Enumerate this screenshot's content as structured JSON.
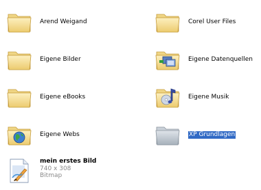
{
  "items": [
    {
      "label": "Arend Weigand",
      "icon": "folder-icon"
    },
    {
      "label": "Corel User Files",
      "icon": "folder-icon"
    },
    {
      "label": "Eigene Bilder",
      "icon": "folder-icon"
    },
    {
      "label": "Eigene Datenquellen",
      "icon": "data-sources-folder-icon"
    },
    {
      "label": "Eigene eBooks",
      "icon": "folder-icon"
    },
    {
      "label": "Eigene Musik",
      "icon": "music-folder-icon"
    },
    {
      "label": "Eigene Webs",
      "icon": "web-folder-icon"
    },
    {
      "label": "XP Grundlagen",
      "icon": "folder-icon",
      "selected": true
    }
  ],
  "file": {
    "name": "mein erstes Bild",
    "dimensions": "740 x 308",
    "type": "Bitmap",
    "icon": "bitmap-file-icon"
  },
  "colors": {
    "folder": "#f6dc8c",
    "folder_grey": "#b8c0c8",
    "selection": "#316ac5"
  }
}
